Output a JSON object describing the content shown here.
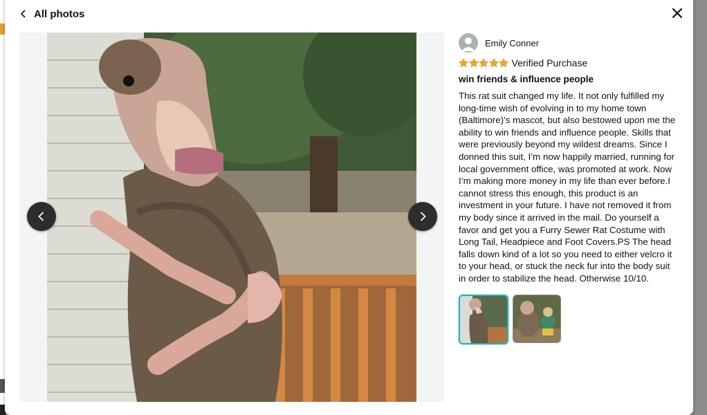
{
  "header": {
    "title": "All photos"
  },
  "reviewer": {
    "name": "Emily Conner"
  },
  "rating": {
    "value": 5,
    "max": 5,
    "badge": "Verified Purchase",
    "star_color": "#f4a41d"
  },
  "review": {
    "title": "win friends & influence people",
    "body": "This rat suit changed my life. It not only fulfilled my long-time wish of evolving in to my home town (Baltimore)’s mascot, but also bestowed upon me the ability to win friends and influence people. Skills that were previously beyond my wildest dreams. Since I donned this suit, I’m now happily married, running for local government office, was promoted at work. Now I’m making more money in my life than ever before.I cannot stress this enough, this product is an investment in your future. I have not removed it from my body since it arrived in the mail. Do yourself a favor and get you a Furry Sewer Rat Costume with Long Tail, Headpiece and Foot Covers.PS The head falls down kind of a lot so you need to either velcro it to your head, or stuck the neck fur into the body suit in order to stabilize the head. Otherwise 10/10."
  },
  "thumbnails": [
    {
      "name": "photo-1",
      "selected": true
    },
    {
      "name": "photo-2",
      "selected": false
    }
  ],
  "icons": {
    "back": "chevron-left-icon",
    "close": "close-icon",
    "prev": "chevron-left-icon",
    "next": "chevron-right-icon",
    "avatar": "user-icon",
    "star": "star-icon"
  },
  "colors": {
    "selected_thumb_border": "#21b4c4",
    "nav_button": "#2d2d2d"
  }
}
